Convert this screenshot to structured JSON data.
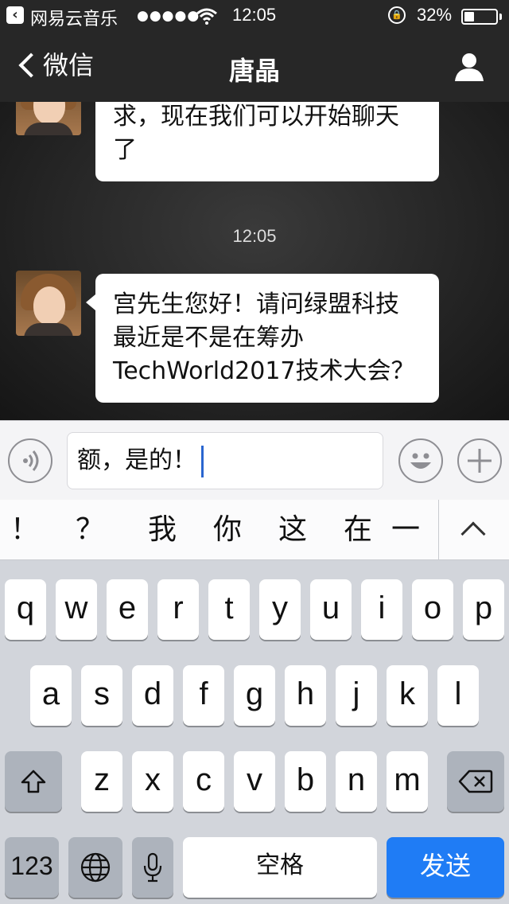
{
  "status_bar": {
    "back_app": "网易云音乐",
    "signal": "●●●●●",
    "time": "12:05",
    "battery_text": "32%",
    "battery_level": 0.32
  },
  "nav": {
    "back_label": "微信",
    "title": "唐晶"
  },
  "chat": {
    "messages": [
      {
        "text": "求，现在我们可以开始聊天\n了"
      },
      {
        "text": "宫先生您好！请问绿盟科技\n最近是不是在筹办\nTechWorld2017技术大会？"
      }
    ],
    "timestamp": "12:05"
  },
  "input": {
    "value": "额，是的！"
  },
  "candidates": [
    "！",
    "？",
    "我",
    "你",
    "这",
    "在",
    "一"
  ],
  "keyboard": {
    "row1": [
      "q",
      "w",
      "e",
      "r",
      "t",
      "y",
      "u",
      "i",
      "o",
      "p"
    ],
    "row2": [
      "a",
      "s",
      "d",
      "f",
      "g",
      "h",
      "j",
      "k",
      "l"
    ],
    "row3": [
      "z",
      "x",
      "c",
      "v",
      "b",
      "n",
      "m"
    ],
    "numbers_label": "123",
    "space_label": "空格",
    "send_label": "发送"
  },
  "colors": {
    "send_key": "#1f7cf5",
    "nav_bg": "#272727",
    "caret": "#2a66d0"
  }
}
